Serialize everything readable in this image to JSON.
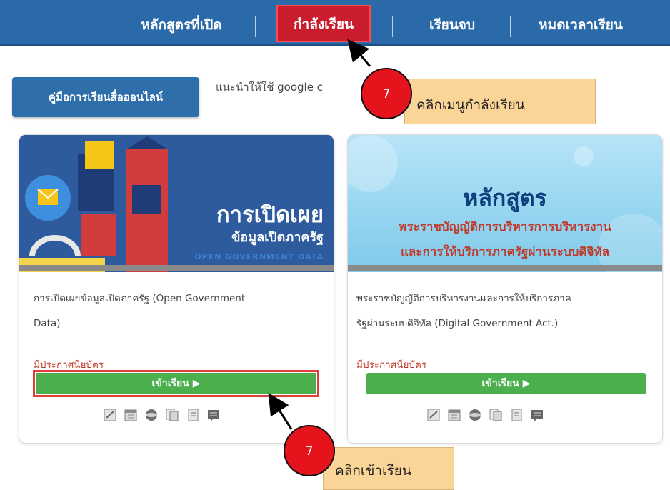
{
  "nav": {
    "items": [
      "หลักสูตรที่เปิด",
      "กำลังเรียน",
      "เรียนจบ",
      "หมดเวลาเรียน"
    ],
    "active_index": 1
  },
  "toolbar": {
    "guide_label": "คู่มือการเรียนสื่อออนไลน์",
    "hint": "แนะนำให้ใช้ google c"
  },
  "courses": [
    {
      "banner_title": "การเปิดเผย",
      "banner_sub": "ข้อมูลเปิดภาครัฐ",
      "banner_tag": "OPEN GOVERNMENT DATA",
      "desc_line1": "การเปิดเผยข้อมูลเปิดภาครัฐ (Open Government",
      "desc_line2": "Data)",
      "certificate": "มีประกาศนียบัตร",
      "enter_label": "เข้าเรียน ▶"
    },
    {
      "banner_title": "หลักสูตร",
      "banner_line1": "พระราชบัญญัติการบริหารการบริหารงาน",
      "banner_line2": "และการให้บริการภาครัฐผ่านระบบดิจิทัล",
      "desc_line1": "พระราชบัญญัติการบริหารงานและการให้บริการภาค",
      "desc_line2": "รัฐผ่านระบบดิจิทัล (Digital Government Act.)",
      "certificate": "มีประกาศนียบัตร",
      "enter_label": "เข้าเรียน ▶"
    }
  ],
  "card_icons": [
    "edit-icon",
    "calendar-icon",
    "globe-icon",
    "copy-icon",
    "document-icon",
    "comment-icon"
  ],
  "callouts": [
    {
      "number": "7",
      "text": "คลิกเมนูกำลังเรียน"
    },
    {
      "number": "7",
      "text": "คลิกเข้าเรียน"
    }
  ],
  "colors": {
    "nav_bg": "#2b6aa8",
    "active_tab": "#c91c2c",
    "enter_button": "#4caf4e",
    "badge": "#e5141c",
    "note_bg": "#fbd598"
  }
}
